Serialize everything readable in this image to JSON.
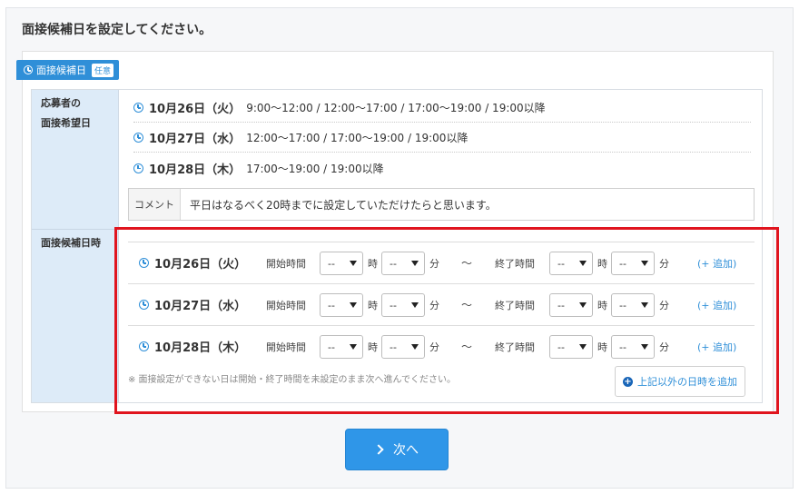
{
  "page": {
    "title": "面接候補日を設定してください。"
  },
  "section": {
    "tag_label": "面接候補日",
    "optional_badge": "任意"
  },
  "labels": {
    "applicant_pref_line1": "応募者の",
    "applicant_pref_line2": "面接希望日",
    "candidate_dates": "面接候補日時"
  },
  "preferences": [
    {
      "date": "10月26日（火）",
      "times": "9:00〜12:00 / 12:00〜17:00 / 17:00〜19:00 / 19:00以降"
    },
    {
      "date": "10月27日（水）",
      "times": "12:00〜17:00 / 17:00〜19:00 / 19:00以降"
    },
    {
      "date": "10月28日（木）",
      "times": "17:00〜19:00 / 19:00以降"
    }
  ],
  "comment": {
    "label": "コメント",
    "text": "平日はなるべく20時までに設定していただけたらと思います。"
  },
  "candidates": [
    {
      "date": "10月26日（火）",
      "start_label": "開始時間",
      "end_label": "終了時間",
      "start_hour": "--",
      "start_min": "--",
      "end_hour": "--",
      "end_min": "--",
      "hour_unit": "時",
      "min_unit": "分",
      "tilde": "〜",
      "add": "(+ 追加)"
    },
    {
      "date": "10月27日（水）",
      "start_label": "開始時間",
      "end_label": "終了時間",
      "start_hour": "--",
      "start_min": "--",
      "end_hour": "--",
      "end_min": "--",
      "hour_unit": "時",
      "min_unit": "分",
      "tilde": "〜",
      "add": "(+ 追加)"
    },
    {
      "date": "10月28日（木）",
      "start_label": "開始時間",
      "end_label": "終了時間",
      "start_hour": "--",
      "start_min": "--",
      "end_hour": "--",
      "end_min": "--",
      "hour_unit": "時",
      "min_unit": "分",
      "tilde": "〜",
      "add": "(+ 追加)"
    }
  ],
  "note": "※ 面接設定ができない日は開始・終了時間を未設定のまま次へ進んでください。",
  "other_dates_button": "上記以外の日時を追加",
  "next_button": "次へ",
  "colors": {
    "accent": "#2f8fd8",
    "highlight": "#e0141e",
    "label_bg": "#ddebf8"
  },
  "icons": [
    "clock-icon",
    "plus-circle-icon",
    "chevron-right-icon",
    "chevron-down-icon"
  ]
}
